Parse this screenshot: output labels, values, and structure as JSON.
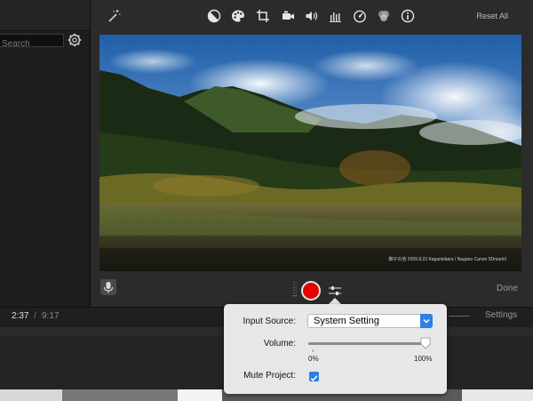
{
  "search": {
    "placeholder": "Search"
  },
  "toolbar": {
    "reset_label": "Reset All",
    "tools": [
      "magic-wand-icon",
      "color-balance-icon",
      "color-palette-icon",
      "crop-icon",
      "camera-icon",
      "volume-icon",
      "equalizer-icon",
      "speedometer-icon",
      "filters-icon",
      "info-icon"
    ]
  },
  "photo": {
    "caption": "御子の池 2009.8.23 Kagamidaira / Nagano Canon 5DmarkII"
  },
  "controls": {
    "done_label": "Done"
  },
  "timeline": {
    "current": "2:37",
    "separator": "/",
    "total": "9:17",
    "settings_label": "Settings"
  },
  "voiceover": {
    "input_source_label": "Input Source:",
    "input_source_value": "System Setting",
    "volume_label": "Volume:",
    "volume_level": 1.0,
    "volume_min": "0%",
    "volume_max": "100%",
    "mute_label": "Mute Project:",
    "mute_checked": true
  },
  "colors": {
    "accent": "#2f7fe3",
    "record": "#e60000"
  }
}
